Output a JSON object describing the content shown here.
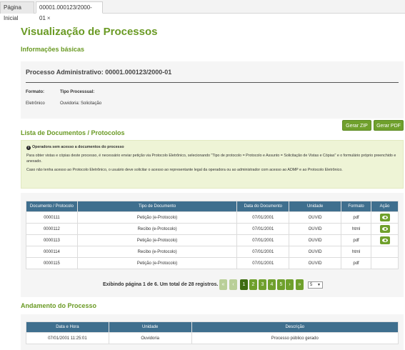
{
  "tabs": [
    {
      "label": "Página Inicial"
    },
    {
      "label": "00001.000123/2000-01",
      "close": "×"
    }
  ],
  "page_title": "Visualização de Processos",
  "basic_info": {
    "section_title": "Informações básicas",
    "process_title": "Processo Administrativo: 00001.000123/2000-01",
    "format_label": "Formato:",
    "format_value": "Eletrônico",
    "type_label": "Tipo Processual:",
    "type_value": "Ouvidoria: Solicitação"
  },
  "actions": {
    "zip": "Gerar ZIP",
    "pdf": "Gerar PDF"
  },
  "documents": {
    "section_title": "Lista de Documentos / Protocolos",
    "notice_title": "Operadora sem acesso a documentos do processo",
    "notice_p1": "Para obter vistas e cópias deste processo, é necessário enviar petição via Protocolo Eletrônico, selecionando \"Tipo de protocolo = Protocolo e Assunto = Solicitação de Vistas e Cópias\" e o formulário próprio preenchido e anexado.",
    "notice_p2": "Caso não tenha acesso ao Protocolo Eletrônico, o usuário deve solicitar o acesso ao representante legal da operadora ou ao administrador com acesso ao ADMP e ao Protocolo Eletrônico.",
    "columns": [
      "Documento / Protocolo",
      "Tipo de Documento",
      "Data do Documento",
      "Unidade",
      "Formato",
      "Ação"
    ],
    "rows": [
      {
        "doc": "0000111",
        "type": "Petição (e-Protocolo)",
        "date": "07/01/2001",
        "unit": "OUVID",
        "format": "pdf",
        "action": true
      },
      {
        "doc": "0000112",
        "type": "Recibo (e-Protocolo)",
        "date": "07/01/2001",
        "unit": "OUVID",
        "format": "html",
        "action": true
      },
      {
        "doc": "0000113",
        "type": "Petição (e-Protocolo)",
        "date": "07/01/2001",
        "unit": "OUVID",
        "format": "pdf",
        "action": true
      },
      {
        "doc": "0000114",
        "type": "Recibo (e-Protocolo)",
        "date": "07/01/2001",
        "unit": "OUVID",
        "format": "html",
        "action": false
      },
      {
        "doc": "0000115",
        "type": "Petição (e-Protocolo)",
        "date": "07/01/2001",
        "unit": "OUVID",
        "format": "pdf",
        "action": false
      }
    ]
  },
  "pagination": {
    "summary": "Exibindo página 1 de 6. Um total de 28 registros.",
    "first": "«",
    "prev": "‹",
    "next": "›",
    "last": "»",
    "pages": [
      "1",
      "2",
      "3",
      "4",
      "5"
    ],
    "current_page": "1",
    "page_size": "5"
  },
  "progress": {
    "section_title": "Andamento do Processo",
    "columns": [
      "Data e Hora",
      "Unidade",
      "Descrição"
    ],
    "rows": [
      {
        "datetime": "07/01/2001 11:25:01",
        "unit": "Ouvidoria",
        "description": "Processo público gerado"
      }
    ]
  },
  "colors": {
    "accent_green": "#6a9a24",
    "table_header": "#3f6f8e",
    "notice_bg": "#eef4d6"
  },
  "icons": {
    "info": "info-icon",
    "view": "eye-icon",
    "close": "close-icon"
  }
}
